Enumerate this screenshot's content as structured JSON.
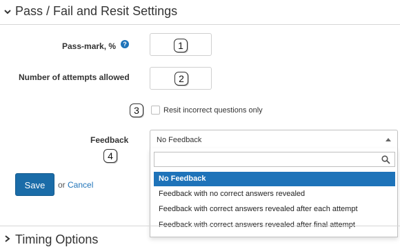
{
  "section": {
    "title": "Pass / Fail and Resit Settings",
    "chevron_icon": "chevron-down-icon"
  },
  "pass_mark": {
    "label": "Pass-mark, %",
    "help_icon": "help-icon",
    "help_glyph": "?",
    "badge": "1",
    "value": ""
  },
  "attempts": {
    "label": "Number of attempts allowed",
    "badge": "2",
    "value": ""
  },
  "resit": {
    "badge": "3",
    "label": "Resit incorrect questions only",
    "checked": false
  },
  "feedback": {
    "label": "Feedback",
    "badge": "4",
    "selected_value": "No Feedback",
    "search_placeholder": "",
    "options": [
      "No Feedback",
      "Feedback with no correct answers revealed",
      "Feedback with correct answers revealed after each attempt",
      "Feedback with correct answers revealed after final attempt"
    ],
    "selected_index": 0
  },
  "actions": {
    "save_label": "Save",
    "or_text": "or",
    "cancel_label": "Cancel"
  },
  "next_section": {
    "title": "Timing Options",
    "chevron_icon": "chevron-right-icon"
  },
  "colors": {
    "accent": "#1e73b9",
    "save_button": "#1a6ca8"
  }
}
